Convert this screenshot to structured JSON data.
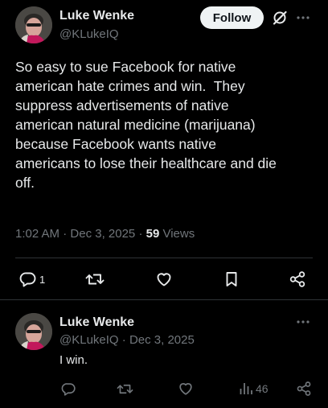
{
  "main_tweet": {
    "author_name": "Luke Wenke",
    "author_handle": "@KLukeIQ",
    "follow_label": "Follow",
    "text": "So easy to sue Facebook for native\namerican hate crimes and win.  They\nsuppress advertisements of native\namerican natural medicine (marijuana)\nbecause Facebook wants native\namericans to lose their healthcare and die\noff.",
    "time": "1:02 AM",
    "date": "Dec 3, 2025",
    "separator": "·",
    "views_count": "59",
    "views_label": "Views",
    "reply_count": "1",
    "icons": {
      "grok": "grok-slash-icon",
      "more": "more-dots-icon",
      "reply": "reply-bubble-icon",
      "retweet": "retweet-icon",
      "like": "heart-icon",
      "bookmark": "bookmark-icon",
      "share": "share-icon"
    }
  },
  "reply_tweet": {
    "author_name": "Luke Wenke",
    "author_handle": "@KLukeIQ",
    "separator": "·",
    "date": "Dec 3, 2025",
    "text": "I win.",
    "views_count": "46",
    "icons": {
      "more": "more-dots-icon",
      "reply": "reply-bubble-icon",
      "retweet": "retweet-icon",
      "like": "heart-icon",
      "views": "bar-chart-icon",
      "share": "share-icon"
    }
  },
  "colors": {
    "background": "#000000",
    "primary_text": "#e7e9ea",
    "secondary_text": "#71767b",
    "divider": "#2f3336",
    "follow_bg": "#eff3f4"
  }
}
